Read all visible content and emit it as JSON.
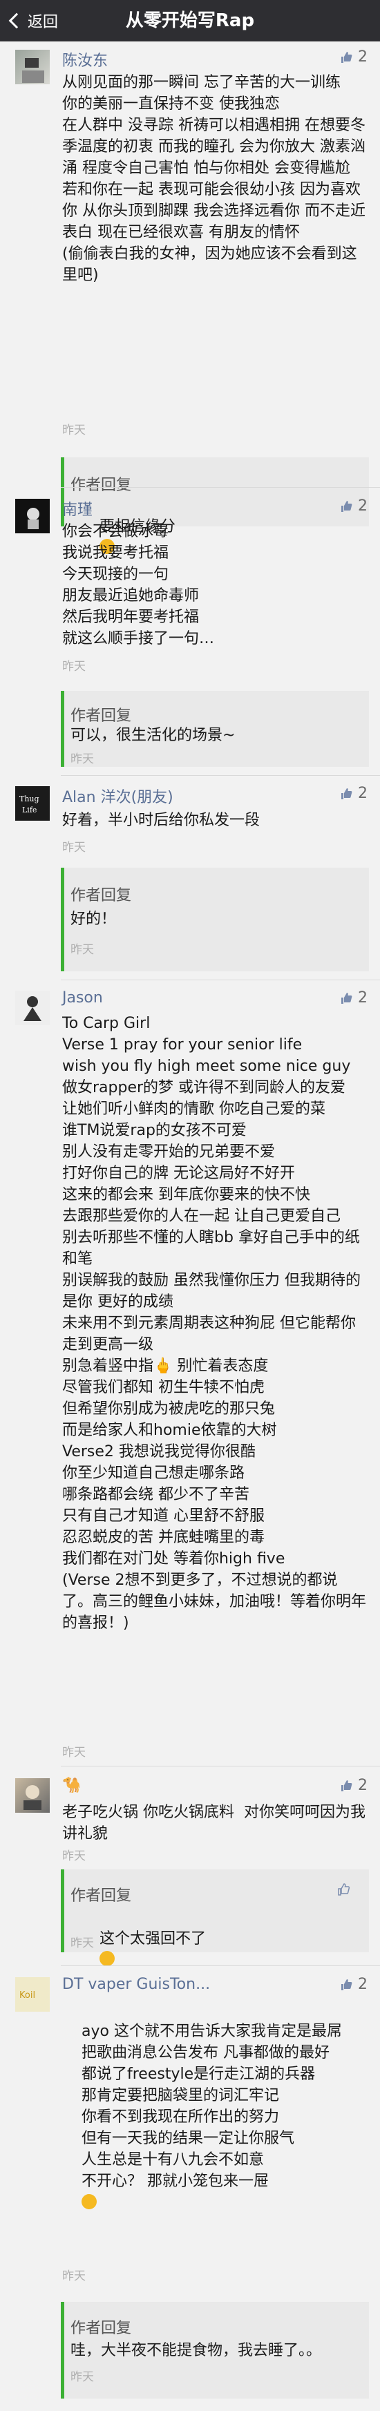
{
  "nav": {
    "back_label": "返回",
    "title": "从零开始写Rap"
  },
  "comments": [
    {
      "author": "陈汝东",
      "likes": "2",
      "text": "从刚见面的那一瞬间 忘了辛苦的大一训练\n你的美丽一直保持不变 使我独恋\n在人群中 没寻踪 祈祷可以相遇相拥 在想要冬 季温度的初衷 而我的瞳孔 会为你放大 激素汹涌 程度令自己害怕 怕与你相处 会变得尴尬 若和你在一起 表现可能会很幼小孩 因为喜欢你 从你头顶到脚踝 我会选择远看你 而不走近表白 现在已经很欢喜 有朋友的情怀\n(偷偷表白我的女神，因为她应该不会看到这里吧)",
      "time": "昨天",
      "reply": {
        "label": "作者回复",
        "text": "要相信缘分",
        "time": "",
        "likes": ""
      }
    },
    {
      "author": "南瑾",
      "likes": "2",
      "text": "你会不会做冰毒\n我说我要考托福\n今天现接的一句\n朋友最近追她命毒师\n然后我明年要考托福\n就这么顺手接了一句…",
      "time": "昨天",
      "reply": {
        "label": "作者回复",
        "text": "可以，很生活化的场景~",
        "time": "昨天",
        "likes": ""
      }
    },
    {
      "author": "Alan 洋次(朋友)",
      "likes": "2",
      "text": "好着，半小时后给你私发一段",
      "time": "昨天",
      "reply": {
        "label": "作者回复",
        "text": "好的！",
        "time": "昨天",
        "likes": ""
      }
    },
    {
      "author": "Jason",
      "likes": "2",
      "text": "To Carp Girl\nVerse 1 pray for your senior life\nwish you fly high meet some nice guy\n做女rapper的梦 或许得不到同龄人的友爱\n让她们听小鲜肉的情歌 你吃自己爱的菜\n谁TM说爱rap的女孩不可爱\n别人没有走零开始的兄弟要不爱\n打好你自己的牌 无论这局好不好开\n这来的都会来 到年底你要来的快不快\n去跟那些爱你的人在一起 让自己更爱自己\n别去听那些不懂的人瞎bb 拿好自己手中的纸和笔\n别误解我的鼓励 虽然我懂你压力 但我期待的是你 更好的成绩\n未来用不到元素周期表这种狗屁 但它能帮你走到更高一级\n别急着竖中指🖕 别忙着表态度\n尽管我们都知 初生牛犊不怕虎\n但希望你别成为被虎吃的那只兔\n而是给家人和homie依靠的大树\nVerse2 我想说我觉得你很酷\n你至少知道自己想走哪条路\n哪条路都会绕 都少不了辛苦\n只有自己才知道 心里舒不舒服\n忍忍蜕皮的苦 并底蛙嘴里的毒\n我们都在对门处 等着你high five\n(Verse 2想不到更多了，不过想说的都说了。高三的鲤鱼小妹妹，加油哦！等着你明年的喜报！)",
      "time": "昨天",
      "reply": null
    },
    {
      "author": "🐪",
      "likes": "2",
      "text": "老子吃火锅 你吃火锅底料  对你笑呵呵因为我讲礼貌",
      "time": "昨天",
      "reply": {
        "label": "作者回复",
        "text": "这个太强回不了",
        "time": "昨天",
        "likes": ""
      }
    },
    {
      "author": "DT vaper GuisTon...",
      "likes": "2",
      "text": "ayo 这个就不用告诉大家我肯定是最屌\n    把歌曲消息公告发布 凡事都做的最好\n    都说了freestyle是行走江湖的兵器\n    那肯定要把脑袋里的词汇牢记\n    你看不到我现在所作出的努力\n    但有一天我的结果一定让你服气\n    人生总是十有八九会不如意\n    不开心？ 那就小笼包来一屉",
      "time": "昨天",
      "reply": {
        "label": "作者回复",
        "text": "哇，大半夜不能提食物，我去睡了。。",
        "time": "昨天",
        "likes": ""
      }
    }
  ],
  "colors": {
    "navbar": "#2e2e32",
    "accent_green": "#3cb034",
    "name_blue": "#5a6f95"
  }
}
